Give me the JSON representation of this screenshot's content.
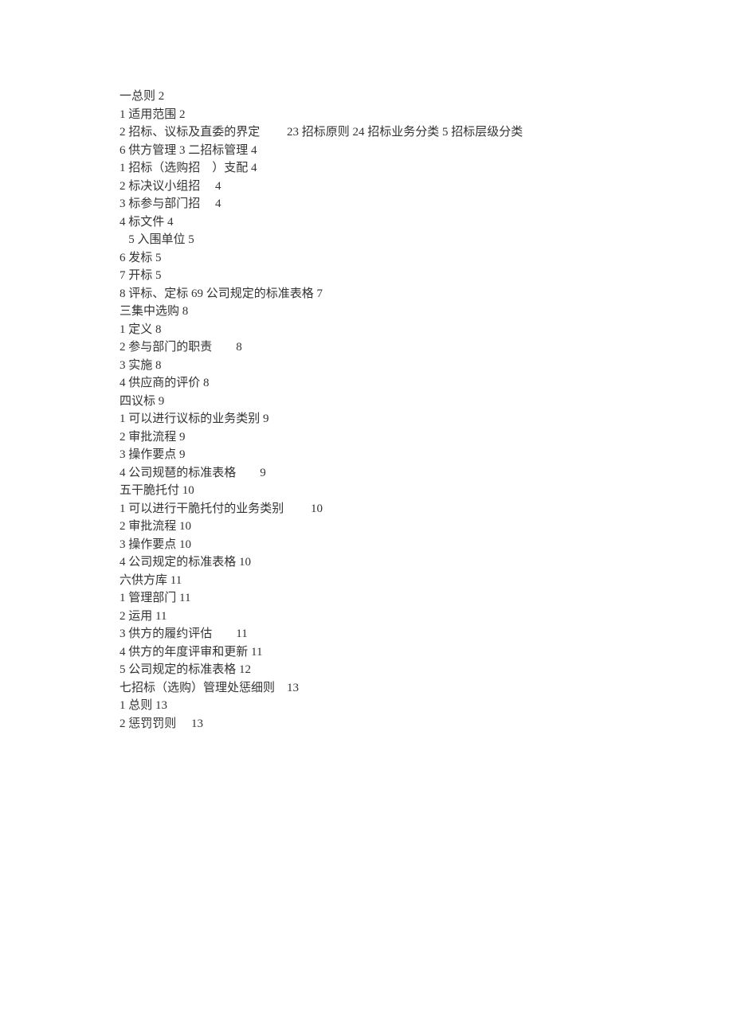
{
  "toc": {
    "lines": [
      "一总则 2",
      "1 适用范围 2",
      "2 招标、议标及直委的界定         23 招标原则 24 招标业务分类 5 招标层级分类",
      "6 供方管理 3 二招标管理 4",
      "1 招标（选购招    ）支配 4",
      "2 标决议小组招     4",
      "3 标参与部门招     4",
      "4 标文件 4",
      "   5 入围单位 5",
      "6 发标 5",
      "7 开标 5",
      "8 评标、定标 69 公司规定的标准表格 7",
      "三集中选购 8",
      "1 定义 8",
      "2 参与部门的职责        8",
      "3 实施 8",
      "4 供应商的评价 8",
      "四议标 9",
      "1 可以进行议标的业务类别 9",
      "2 审批流程 9",
      "3 操作要点 9",
      "4 公司规琶的标准表格        9",
      "五干脆托付 10",
      "1 可以进行干脆托付的业务类别         10",
      "2 审批流程 10",
      "3 操作要点 10",
      "4 公司规定的标准表格 10",
      "六供方库 11",
      "1 管理部门 11",
      "2 运用 11",
      "3 供方的履约评估        11",
      "4 供方的年度评审和更新 11",
      "5 公司规定的标准表格 12",
      "七招标（选购）管理处惩细则    13",
      "1 总则 13",
      "2 惩罚罚则     13"
    ]
  }
}
